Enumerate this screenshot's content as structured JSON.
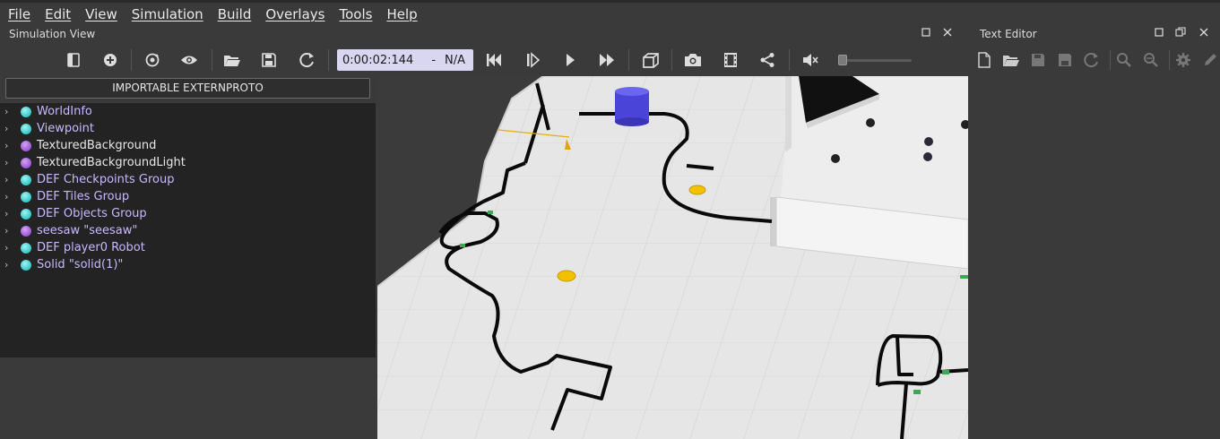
{
  "menu": [
    "File",
    "Edit",
    "View",
    "Simulation",
    "Build",
    "Overlays",
    "Tools",
    "Help"
  ],
  "simulation_view": {
    "title": "Simulation View",
    "time": "0:00:02:144",
    "speed": "N/A",
    "toolbar_icons": [
      "hide-scene-tree-icon",
      "add-node-icon",
      "reset-view-icon",
      "view-eye-icon",
      "open-world-icon",
      "save-world-icon",
      "reload-world-icon",
      "reset-simulation-icon",
      "step-icon",
      "run-realtime-icon",
      "fast-forward-icon",
      "projection-mode-icon",
      "screenshot-icon",
      "record-movie-icon",
      "share-icon",
      "mute-icon"
    ],
    "volume_level": 0
  },
  "scene_tree": {
    "proto_button": "IMPORTABLE EXTERNPROTO",
    "items": [
      {
        "label": "WorldInfo",
        "color": "cyan"
      },
      {
        "label": "Viewpoint",
        "color": "cyan"
      },
      {
        "label": "TexturedBackground",
        "color": "purple"
      },
      {
        "label": "TexturedBackgroundLight",
        "color": "purple"
      },
      {
        "label": "DEF Checkpoints Group",
        "color": "cyan"
      },
      {
        "label": "DEF Tiles Group",
        "color": "cyan"
      },
      {
        "label": "DEF Objects Group",
        "color": "cyan"
      },
      {
        "label": "seesaw \"seesaw\"",
        "color": "purple"
      },
      {
        "label": "DEF player0 Robot",
        "color": "cyan"
      },
      {
        "label": "Solid \"solid(1)\"",
        "color": "cyan"
      }
    ]
  },
  "text_editor": {
    "title": "Text Editor",
    "toolbar_icons": [
      "new-file-icon",
      "open-file-icon",
      "save-file-icon",
      "save-as-icon",
      "revert-icon",
      "find-icon",
      "replace-icon",
      "settings-icon",
      "edit-icon"
    ]
  },
  "colors": {
    "time_box": "#d9d6f2",
    "label_highlight": "#c9b8ff",
    "robot": "#4a45d8",
    "checkpoint": "#f2c200"
  }
}
